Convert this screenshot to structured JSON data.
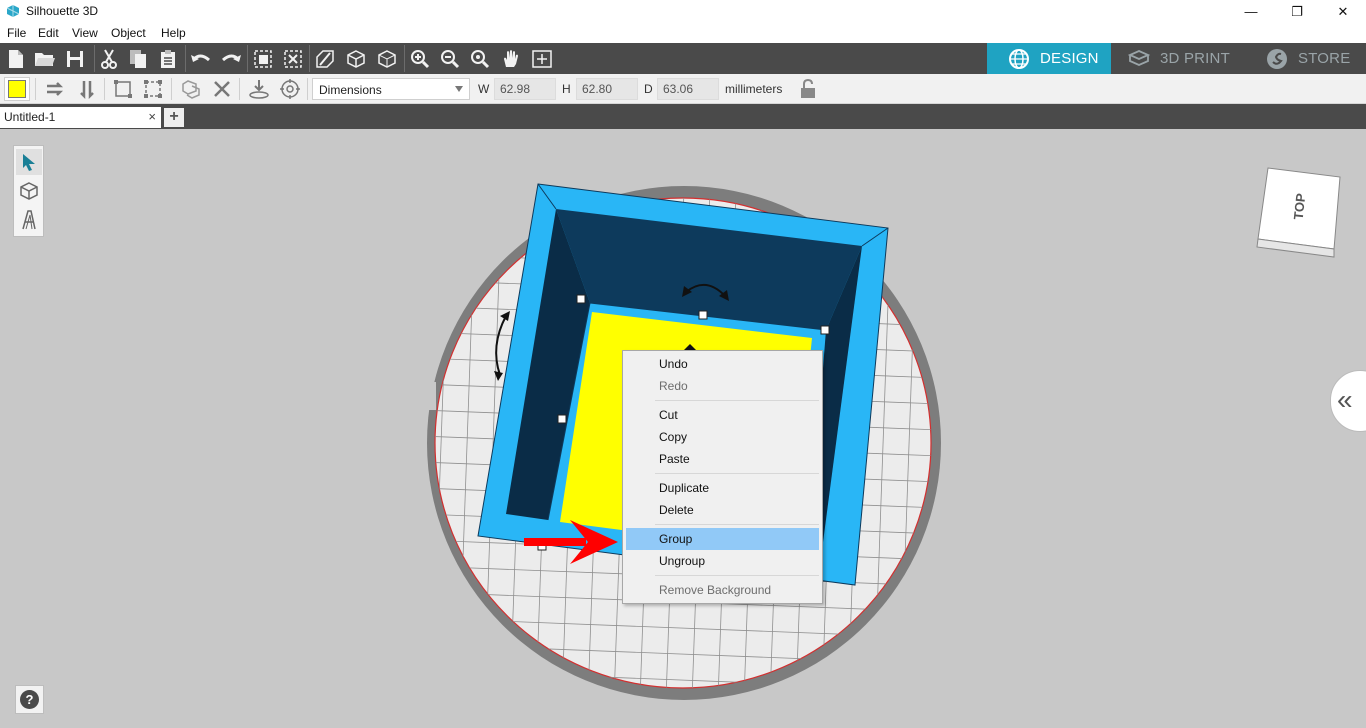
{
  "window": {
    "title": "Silhouette 3D",
    "minimize_glyph": "—",
    "restore_glyph": "❐",
    "close_glyph": "✕"
  },
  "menu": [
    "File",
    "Edit",
    "View",
    "Object",
    "Help"
  ],
  "main_toolbar": {
    "icons": [
      "new-file-icon",
      "open-folder-icon",
      "save-icon",
      "cut-icon",
      "copy-icon",
      "paste-icon",
      "undo-icon",
      "redo-icon",
      "group-icon",
      "ungroup-icon",
      "extrude-icon",
      "cube-icon",
      "cube-outline-icon",
      "zoom-in-icon",
      "zoom-out-icon",
      "zoom-fit-icon",
      "pan-hand-icon",
      "fit-view-icon"
    ]
  },
  "mode_tabs": [
    {
      "label": "DESIGN",
      "icon": "globe-icon",
      "active": true
    },
    {
      "label": "3D PRINT",
      "icon": "printer-icon",
      "active": false
    },
    {
      "label": "STORE",
      "icon": "store-icon",
      "active": false
    }
  ],
  "properties": {
    "fill_color": "#ffff00",
    "dimensions_select": "Dimensions",
    "w_label": "W",
    "w_value": "62.98",
    "h_label": "H",
    "h_value": "62.80",
    "d_label": "D",
    "d_value": "63.06",
    "units": "millimeters",
    "lock_icon": "unlock-icon"
  },
  "document": {
    "tab_name": "Untitled-1",
    "close_glyph": "×",
    "new_tab_glyph": "+"
  },
  "tools": [
    "select-arrow-icon",
    "cube-tool-icon",
    "text-tool-icon"
  ],
  "view_cube": {
    "face_label": "TOP"
  },
  "side_panel": {
    "collapse_glyph": "«"
  },
  "help": {
    "glyph": "?"
  },
  "context_menu": {
    "items": [
      {
        "label": "Undo",
        "enabled": true
      },
      {
        "label": "Redo",
        "enabled": false
      },
      {
        "label": "Cut",
        "enabled": true
      },
      {
        "label": "Copy",
        "enabled": true
      },
      {
        "label": "Paste",
        "enabled": true
      },
      {
        "label": "Duplicate",
        "enabled": true
      },
      {
        "label": "Delete",
        "enabled": true
      },
      {
        "label": "Group",
        "enabled": true,
        "highlighted": true
      },
      {
        "label": "Ungroup",
        "enabled": true
      },
      {
        "label": "Remove Background",
        "enabled": false
      }
    ]
  },
  "colors": {
    "accent": "#1fa3c2",
    "toolbar_dark": "#4a4a4a",
    "model_outer": "#29b6f6",
    "model_inner": "#0d3a5c",
    "model_floor": "#ffff00",
    "arrow": "#ff0000",
    "menu_highlight": "#91c9f7"
  }
}
